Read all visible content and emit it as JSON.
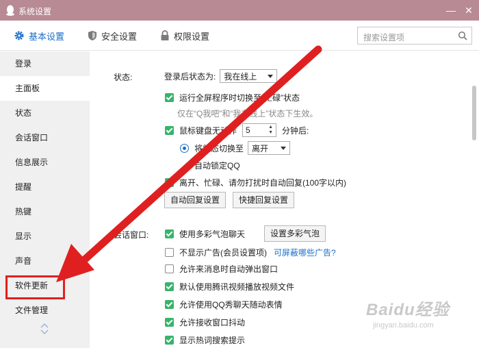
{
  "window": {
    "title": "系统设置",
    "minimize": "—",
    "close": "✕"
  },
  "tabs": [
    {
      "label": "基本设置",
      "icon": "gear-icon",
      "active": true
    },
    {
      "label": "安全设置",
      "icon": "shield-icon",
      "active": false
    },
    {
      "label": "权限设置",
      "icon": "lock-icon",
      "active": false
    }
  ],
  "search": {
    "placeholder": "搜索设置项"
  },
  "sidebar": {
    "items": [
      {
        "label": "登录"
      },
      {
        "label": "主面板"
      },
      {
        "label": "状态"
      },
      {
        "label": "会话窗口"
      },
      {
        "label": "信息展示"
      },
      {
        "label": "提醒"
      },
      {
        "label": "热键"
      },
      {
        "label": "显示"
      },
      {
        "label": "声音"
      },
      {
        "label": "软件更新"
      },
      {
        "label": "文件管理"
      }
    ]
  },
  "status_section": {
    "label": "状态:",
    "after_login_label": "登录后状态为:",
    "after_login_value": "我在线上",
    "fullscreen_busy": "运行全屏程序时切换至“忙碌”状态",
    "fullscreen_note": "仅在“Q我吧”和“我在线上”状态下生效。",
    "idle_prefix": "鼠标键盘无动作",
    "idle_minutes": "5",
    "idle_suffix": "分钟后:",
    "switch_status_label": "将状态切换至",
    "switch_status_value": "离开",
    "auto_lock": "自动锁定QQ",
    "auto_reply": "离开、忙碌、请勿打扰时自动回复(100字以内)",
    "auto_reply_button": "自动回复设置",
    "quick_reply_button": "快捷回复设置"
  },
  "chat_section": {
    "label": "会话窗口:",
    "bubble": "使用多彩气泡聊天",
    "bubble_button": "设置多彩气泡",
    "no_ads": "不显示广告(会员设置项)",
    "ads_link": "可屏蔽哪些广告?",
    "popup": "允许来消息时自动弹出窗口",
    "tencent_video": "默认使用腾讯视频播放视频文件",
    "qq_show": "允许使用QQ秀聊天随动表情",
    "shake": "允许接收窗口抖动",
    "hot_words": "显示热词搜索提示"
  },
  "watermark": {
    "brand": "Baidu经验",
    "url": "jingyan.baidu.com"
  },
  "colors": {
    "titlebar": "#b88a93",
    "accent": "#1b6fc7",
    "checkbox": "#37b46a",
    "annotation": "#e02020",
    "sidebar_bg": "#f0f0f0"
  }
}
